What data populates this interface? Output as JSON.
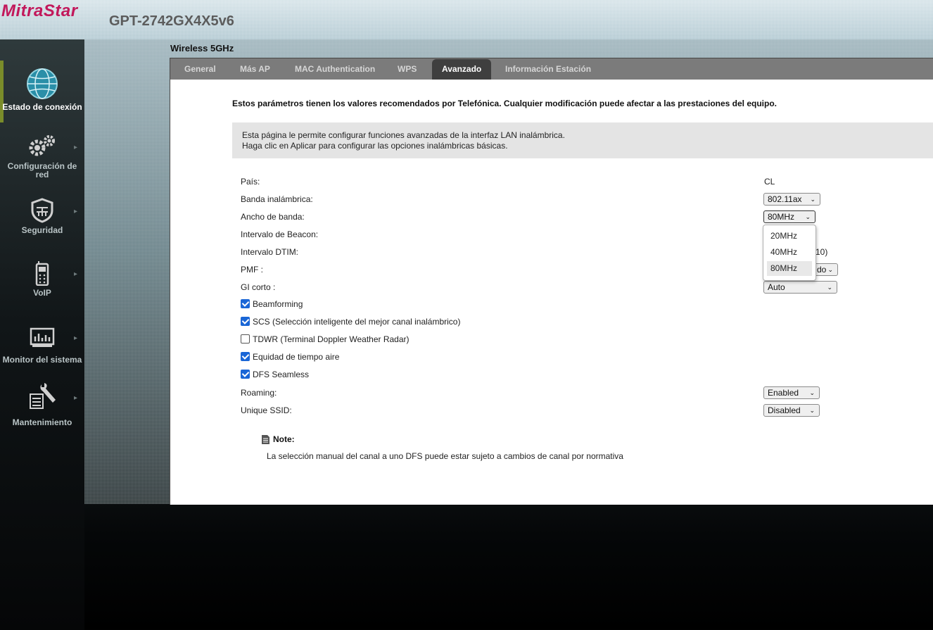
{
  "header": {
    "brand": "MitraStar",
    "model": "GPT-2742GX4X5v6"
  },
  "sidebar": {
    "items": [
      {
        "label": "Estado de conexión",
        "icon": "globe-icon",
        "active": true
      },
      {
        "label": "Configuración de red",
        "icon": "gears-icon"
      },
      {
        "label": "Seguridad",
        "icon": "shield-icon"
      },
      {
        "label": "VoIP",
        "icon": "phone-icon"
      },
      {
        "label": "Monitor del sistema",
        "icon": "monitor-icon"
      },
      {
        "label": "Mantenimiento",
        "icon": "wrench-icon"
      }
    ]
  },
  "panel": {
    "title": "Wireless 5GHz",
    "tabs": [
      "General",
      "Más AP",
      "MAC Authentication",
      "WPS",
      "Avanzado",
      "Información Estación"
    ],
    "active_tab": "Avanzado",
    "notice": "Estos parámetros tienen los valores recomendados por Telefónica. Cualquier modificación puede afectar a las prestaciones del equipo.",
    "info": [
      "Esta página le permite configurar funciones avanzadas de la interfaz LAN inalámbrica.",
      "Haga clic en Aplicar para configurar las opciones inalámbricas básicas."
    ],
    "fields": {
      "pais": {
        "label": "País:",
        "value": "CL"
      },
      "banda": {
        "label": "Banda inalámbrica:",
        "value": "802.11ax"
      },
      "ancho": {
        "label": "Ancho de banda:",
        "value": "80MHz"
      },
      "beacon": {
        "label": "Intervalo de Beacon:"
      },
      "dtim": {
        "label": "Intervalo DTIM:",
        "value_fragment": "10)"
      },
      "pmf": {
        "label": "PMF :",
        "value_fragment": "do"
      },
      "gi": {
        "label": "GI corto :",
        "value": "Auto"
      },
      "roaming": {
        "label": "Roaming:",
        "value": "Enabled"
      },
      "ssid": {
        "label": "Unique SSID:",
        "value": "Disabled"
      }
    },
    "checkboxes": [
      {
        "label": "Beamforming",
        "checked": true
      },
      {
        "label": "SCS (Selección inteligente del mejor canal inalámbrico)",
        "checked": true
      },
      {
        "label": "TDWR (Terminal Doppler Weather Radar)",
        "checked": false
      },
      {
        "label": "Equidad de tiempo aire",
        "checked": true
      },
      {
        "label": "DFS Seamless",
        "checked": true
      }
    ],
    "dropdown_options": [
      "20MHz",
      "40MHz",
      "80MHz"
    ],
    "note": {
      "title": "Note:",
      "text": "La selección manual del canal a uno DFS puede estar sujeto a cambios de canal por normativa"
    }
  },
  "colors": {
    "brand": "#c2185b",
    "tab_bar": "#7b7b7b",
    "tab_active": "#3f3f3f",
    "checkbox": "#1a66d6"
  }
}
